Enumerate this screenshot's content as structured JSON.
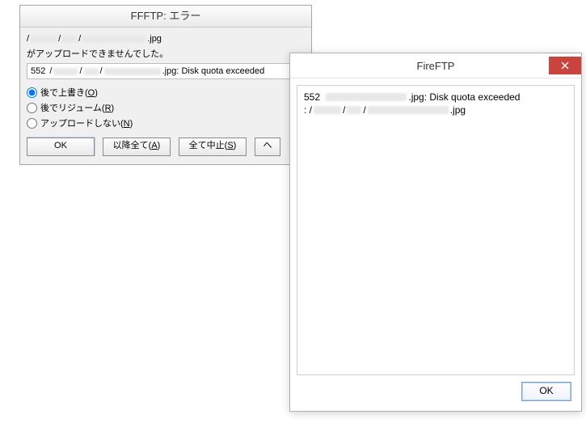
{
  "ffftp": {
    "title": "FFFTP: エラー",
    "path_ext": ".jpg",
    "upload_failed": "がアップロードできませんでした。",
    "status_code": "552",
    "status_text": ".jpg: Disk quota exceeded",
    "radios": {
      "overwrite": "後で上書き",
      "overwrite_mnemonic": "O",
      "resume": "後でリジューム",
      "resume_mnemonic": "R",
      "skip": "アップロードしない",
      "skip_mnemonic": "N"
    },
    "buttons": {
      "ok": "OK",
      "all_after": "以降全て",
      "all_after_mnemonic": "A",
      "all_stop": "全て中止",
      "all_stop_mnemonic": "S",
      "help_partial": "ヘ"
    }
  },
  "fireftp": {
    "title": "FireFTP",
    "line1_code": "552",
    "line1_text": ".jpg: Disk quota exceeded",
    "line2_prefix": ": /",
    "line2_ext": ".jpg",
    "ok": "OK"
  }
}
